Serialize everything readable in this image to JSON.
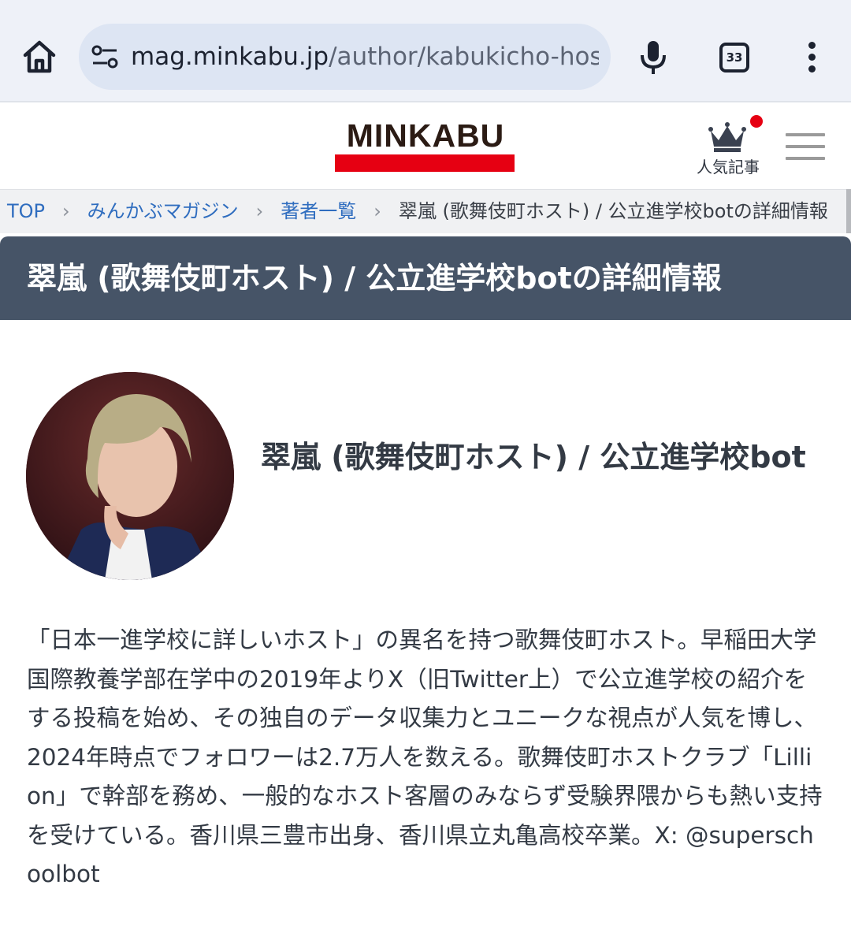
{
  "browser": {
    "url_domain": "mag.minkabu.jp",
    "url_path": "/author/kabukicho-host/",
    "tab_count": "33"
  },
  "header": {
    "logo_text": "MINKABU",
    "popular_label": "人気記事",
    "colors": {
      "brand_red": "#e60012",
      "title_band": "#465467",
      "link_blue": "#2f6dbf"
    }
  },
  "breadcrumb": {
    "items": [
      "TOP",
      "みんかぶマガジン",
      "著者一覧",
      "翠嵐 (歌舞伎町ホスト) / 公立進学校botの詳細情報"
    ]
  },
  "page": {
    "title": "翠嵐 (歌舞伎町ホスト) / 公立進学校botの詳細情報"
  },
  "author": {
    "name": "翠嵐 (歌舞伎町ホスト) / 公立進学校bot",
    "bio": "「日本一進学校に詳しいホスト」の異名を持つ歌舞伎町ホスト。早稲田大学国際教養学部在学中の2019年よりX（旧Twitter上）で公立進学校の紹介をする投稿を始め、その独自のデータ収集力とユニークな視点が人気を博し、2024年時点でフォロワーは2.7万人を数える。歌舞伎町ホストクラブ「Lillion」で幹部を務め、一般的なホスト客層のみならず受験界隈からも熱い支持を受けている。香川県三豊市出身、香川県立丸亀高校卒業。X: @superschoolbot"
  },
  "icons": [
    "home-icon",
    "site-settings-icon",
    "mic-icon",
    "tab-switcher-icon",
    "more-vert-icon",
    "crown-icon",
    "hamburger-menu-icon",
    "chevron-right-icon"
  ]
}
